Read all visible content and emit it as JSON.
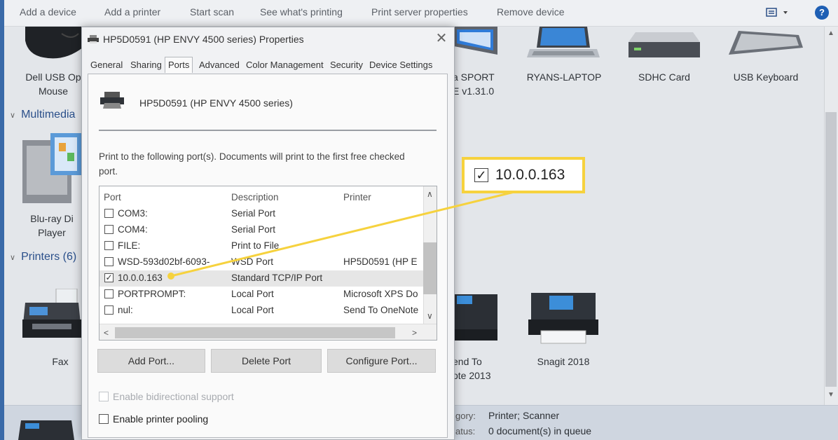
{
  "toolbar": {
    "add_device": "Add a device",
    "add_printer": "Add a printer",
    "start_scan": "Start scan",
    "see_printing": "See what's printing",
    "print_server": "Print server properties",
    "remove_device": "Remove device",
    "help": "?"
  },
  "background": {
    "devices_top": [
      {
        "label_line1": "Dell USB Op",
        "label_line2": "Mouse",
        "icon": "mouse-icon"
      },
      {
        "label_line1": "a SPORT",
        "label_line2": "E v1.31.0",
        "icon": "tablet-icon"
      },
      {
        "label_line1": "RYANS-LAPTOP",
        "label_line2": "",
        "icon": "laptop-icon"
      },
      {
        "label_line1": "SDHC Card",
        "label_line2": "",
        "icon": "drive-icon"
      },
      {
        "label_line1": "USB Keyboard",
        "label_line2": "",
        "icon": "keyboard-icon"
      }
    ],
    "section_multimedia": "Multimedia",
    "multimedia_device": {
      "label_line1": "Blu-ray Di",
      "label_line2": "Player",
      "icon": "media-server-icon"
    },
    "section_printers": "Printers (6)",
    "printers": [
      {
        "label_line1": "Fax",
        "label_line2": "",
        "icon": "fax-icon"
      },
      {
        "label_line1": "end To",
        "label_line2": "ote 2013",
        "icon": "printer-icon"
      },
      {
        "label_line1": "Snagit 2018",
        "label_line2": "",
        "icon": "printer-icon"
      }
    ],
    "status": {
      "category_key": "gory:",
      "category_value": "Printer; Scanner",
      "status_key": "atus:",
      "status_value": "0 document(s) in queue"
    }
  },
  "dialog": {
    "title": "HP5D0591 (HP ENVY 4500 series) Properties",
    "close": "✕",
    "tabs": [
      "General",
      "Sharing",
      "Ports",
      "Advanced",
      "Color Management",
      "Security",
      "Device Settings"
    ],
    "active_tab": "Ports",
    "printer_name": "HP5D0591 (HP ENVY 4500 series)",
    "instructions": "Print to the following port(s). Documents will print to the first free checked port.",
    "columns": {
      "port": "Port",
      "description": "Description",
      "printer": "Printer"
    },
    "ports": [
      {
        "port": "COM3:",
        "description": "Serial Port",
        "printer": "",
        "checked": false
      },
      {
        "port": "COM4:",
        "description": "Serial Port",
        "printer": "",
        "checked": false
      },
      {
        "port": "FILE:",
        "description": "Print to File",
        "printer": "",
        "checked": false
      },
      {
        "port": "WSD-593d02bf-6093-",
        "description": "WSD Port",
        "printer": "HP5D0591 (HP E",
        "checked": false
      },
      {
        "port": "10.0.0.163",
        "description": "Standard TCP/IP Port",
        "printer": "",
        "checked": true
      },
      {
        "port": "PORTPROMPT:",
        "description": "Local Port",
        "printer": "Microsoft XPS Do",
        "checked": false
      },
      {
        "port": "nul:",
        "description": "Local Port",
        "printer": "Send To OneNote",
        "checked": false
      }
    ],
    "buttons": {
      "add_port": "Add Port...",
      "delete_port": "Delete Port",
      "configure_port": "Configure Port..."
    },
    "enable_bidirectional": "Enable bidirectional support",
    "enable_pooling": "Enable printer pooling"
  },
  "callout": {
    "check": "✓",
    "text": "10.0.0.163"
  },
  "colors": {
    "highlight": "#f6d23e",
    "accent": "#1e5fb4"
  }
}
